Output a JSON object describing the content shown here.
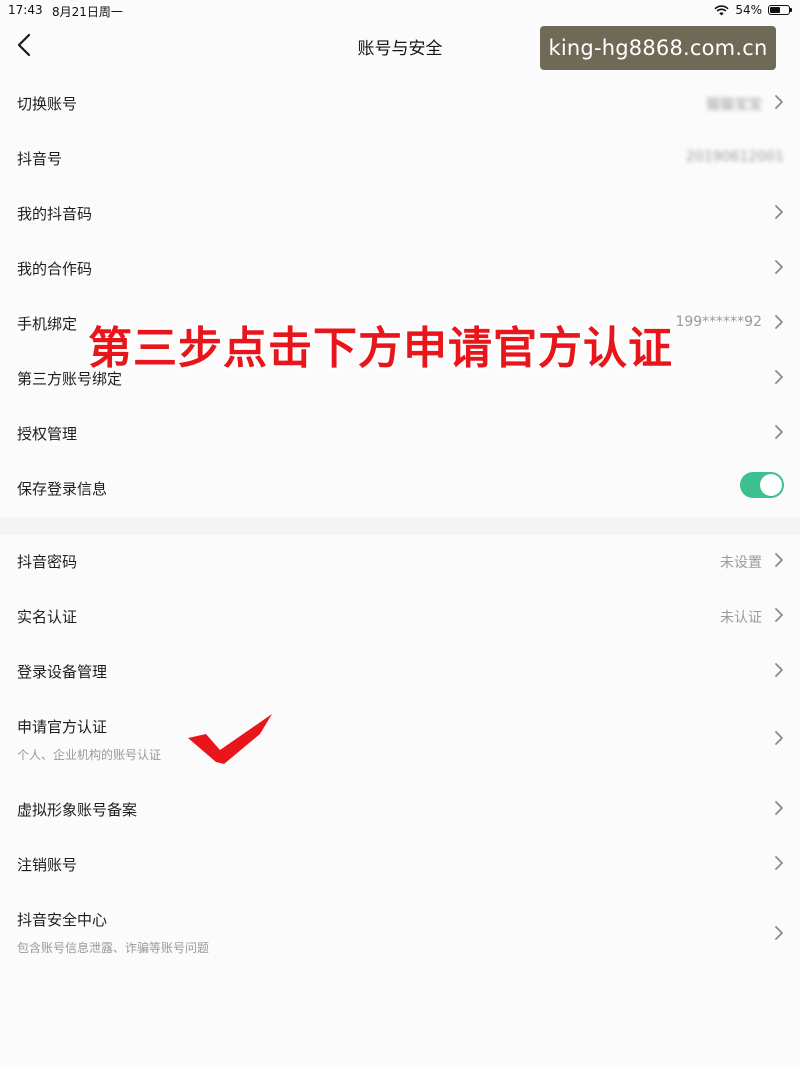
{
  "status_bar": {
    "time": "17:43",
    "date": "8月21日周一",
    "battery": "54%",
    "battery_level": 0.54
  },
  "nav": {
    "title": "账号与安全"
  },
  "watermark": {
    "text": "king-hg8868.com.cn"
  },
  "annotation": {
    "banner": "第三步点击下方申请官方认证"
  },
  "rows": [
    {
      "label": "切换账号",
      "value": "猫猫宝宝"
    },
    {
      "label": "抖音号",
      "value": "20190612001"
    },
    {
      "label": "我的抖音码"
    },
    {
      "label": "我的合作码"
    },
    {
      "label": "手机绑定",
      "value": "199******92"
    },
    {
      "label": "第三方账号绑定"
    },
    {
      "label": "授权管理"
    },
    {
      "label": "保存登录信息"
    },
    {
      "label": "抖音密码",
      "value": "未设置"
    },
    {
      "label": "实名认证",
      "value": "未认证"
    },
    {
      "label": "登录设备管理"
    },
    {
      "label": "申请官方认证",
      "sub": "个人、企业机构的账号认证"
    },
    {
      "label": "虚拟形象账号备案"
    },
    {
      "label": "注销账号"
    },
    {
      "label": "抖音安全中心",
      "sub": "包含账号信息泄露、诈骗等账号问题"
    }
  ],
  "colors": {
    "toggle_on": "#3cc08f",
    "annotation_red": "#e8161b"
  }
}
